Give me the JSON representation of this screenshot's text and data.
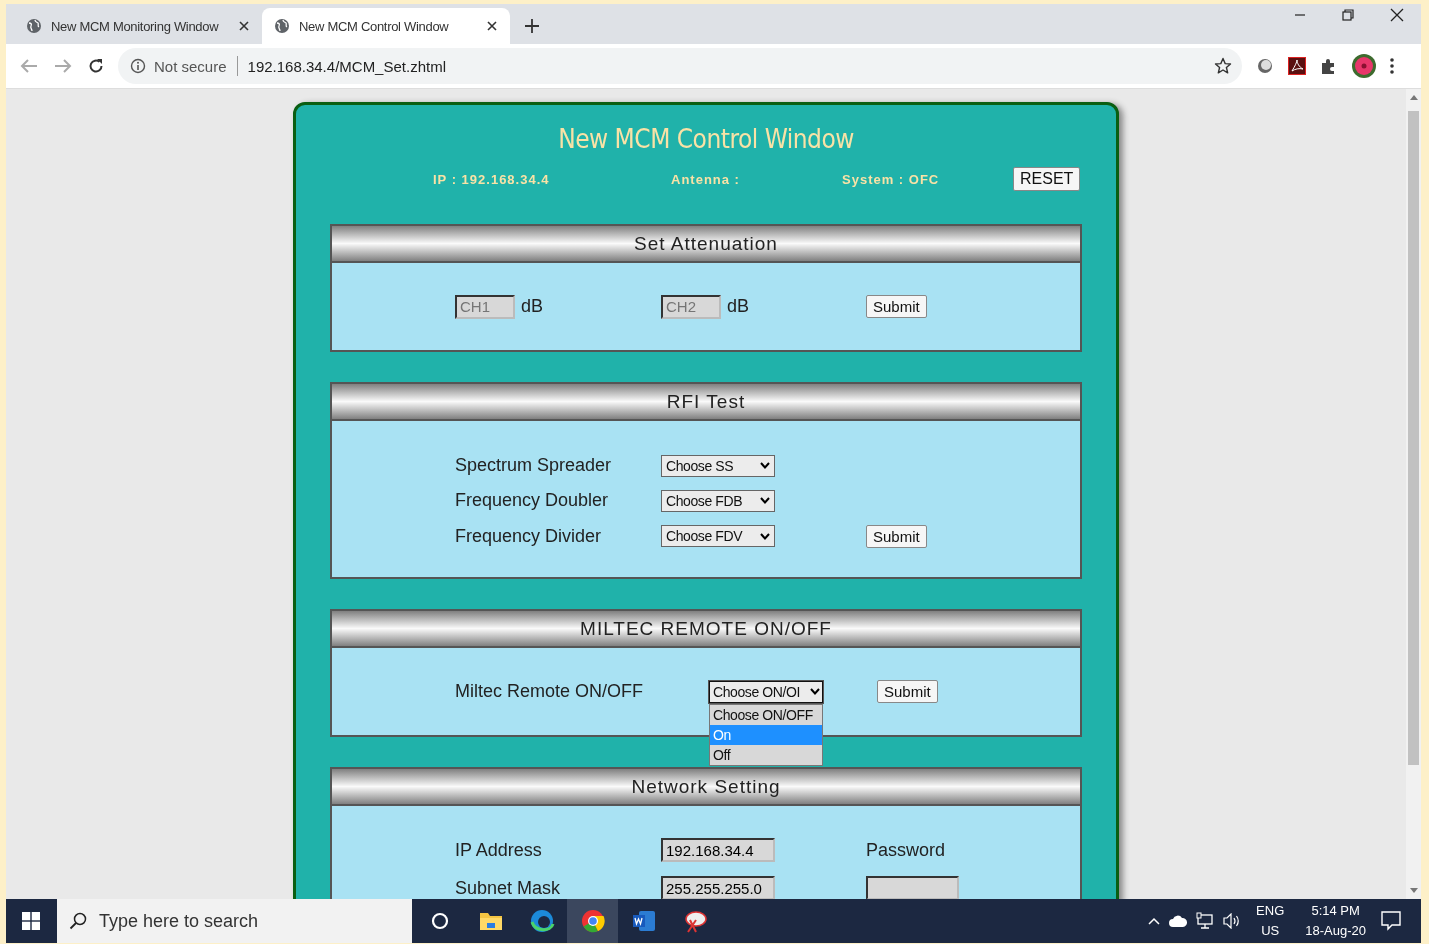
{
  "browser": {
    "tabs": [
      {
        "title": "New MCM Monitoring Window",
        "selected": false
      },
      {
        "title": "New MCM Control Window",
        "selected": true
      }
    ],
    "address": {
      "security": "Not secure",
      "url": "192.168.34.4/MCM_Set.zhtml"
    }
  },
  "page": {
    "title": "New MCM Control Window",
    "info": [
      "IP : 192.168.34.4",
      "Antenna :",
      "System : OFC"
    ],
    "reset_button": "RESET",
    "sections": [
      {
        "kind": "attenuation",
        "title": "Set Attenuation",
        "fields": [
          {
            "placeholder": "CH1",
            "unit": "dB"
          },
          {
            "placeholder": "CH2",
            "unit": "dB"
          }
        ],
        "submit": "Submit"
      },
      {
        "kind": "selects",
        "title": "RFI Test",
        "rows": [
          {
            "label": "Spectrum Spreader",
            "select": "Choose SS"
          },
          {
            "label": "Frequency Doubler",
            "select": "Choose FDB"
          },
          {
            "label": "Frequency Divider",
            "select": "Choose FDV"
          }
        ],
        "submit": "Submit"
      },
      {
        "kind": "dropdown",
        "title": "MILTEC REMOTE ON/OFF",
        "label": "Miltec Remote ON/OFF",
        "select": "Choose ON/OI",
        "expanded": true,
        "options": [
          {
            "label": "Choose ON/OFF",
            "selected": false
          },
          {
            "label": "On",
            "selected": true
          },
          {
            "label": "Off",
            "selected": false
          }
        ],
        "submit": "Submit"
      },
      {
        "kind": "network",
        "title": "Network Setting",
        "rows": [
          {
            "label": "IP Address",
            "value": "192.168.34.4",
            "side_label": "Password"
          },
          {
            "label": "Subnet Mask",
            "value": "255.255.255.0",
            "side_field": true
          }
        ]
      }
    ]
  },
  "taskbar": {
    "search_placeholder": "Type here to search",
    "language": [
      "ENG",
      "US"
    ],
    "time": "5:14 PM",
    "date": "18-Aug-20"
  }
}
